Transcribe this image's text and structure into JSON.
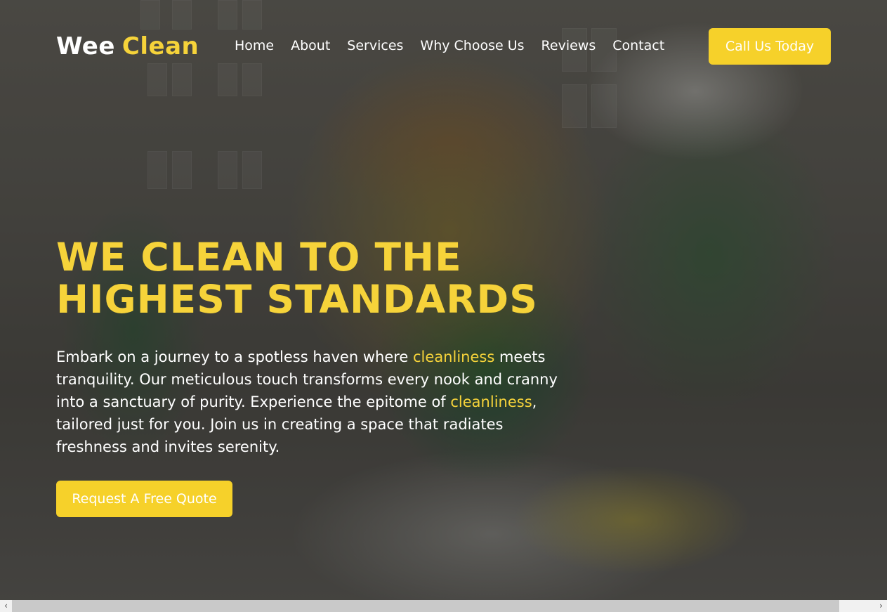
{
  "header": {
    "logo_part1": "Wee",
    "logo_part2": "Clean",
    "nav": [
      {
        "label": "Home"
      },
      {
        "label": "About"
      },
      {
        "label": "Services"
      },
      {
        "label": "Why Choose Us"
      },
      {
        "label": "Reviews"
      },
      {
        "label": "Contact"
      }
    ],
    "cta_label": "Call Us Today"
  },
  "hero": {
    "title_line1": "WE CLEAN TO THE",
    "title_line2": "HIGHEST STANDARDS",
    "paragraph": {
      "part1": "Embark on a journey to a spotless haven where ",
      "highlight1": "cleanliness",
      "part2": " meets tranquility. Our meticulous touch transforms every nook and cranny into a sanctuary of purity. Experience the epitome of ",
      "highlight2": "cleanliness",
      "part3": ", tailored just for you. Join us in creating a space that radiates freshness and invites serenity."
    },
    "cta_label": "Request A Free Quote"
  },
  "scrollbar": {
    "left_arrow": "‹",
    "right_arrow": "›"
  },
  "colors": {
    "accent": "#f6d33a",
    "button": "#f6d12a",
    "text": "#ffffff"
  },
  "icons": {
    "scroll_left": "chevron-left-icon",
    "scroll_right": "chevron-right-icon"
  }
}
